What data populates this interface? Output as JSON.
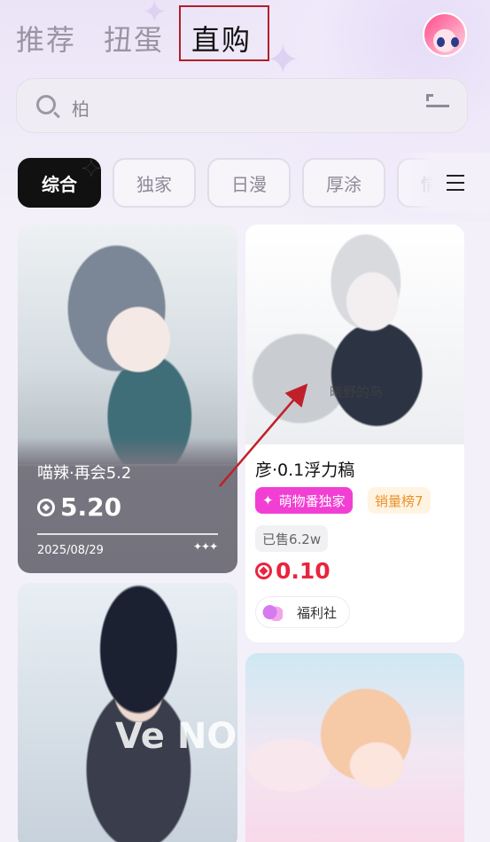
{
  "top_tabs": [
    {
      "label": "推荐",
      "active": false
    },
    {
      "label": "扭蛋",
      "active": false
    },
    {
      "label": "直购",
      "active": true
    }
  ],
  "search": {
    "value": "柏"
  },
  "categories": [
    {
      "label": "综合",
      "active": true
    },
    {
      "label": "独家",
      "active": false
    },
    {
      "label": "日漫",
      "active": false
    },
    {
      "label": "厚涂",
      "active": false
    },
    {
      "label": "情侣",
      "active": false
    }
  ],
  "cards": [
    {
      "title": "喵辣·再会5.2",
      "price": "5.20",
      "date": "2025/08/29",
      "sparkle": "✦✦✦"
    },
    {
      "title": "彦·0.1浮力稿",
      "watermark": "曦野的鸟",
      "tags": [
        "萌物番独家",
        "销量榜7"
      ],
      "sold": "已售6.2w",
      "price": "0.10",
      "shop": "福利社"
    },
    {
      "overlay": "Ve NO"
    },
    {}
  ],
  "colors": {
    "accent_red": "#e8253e",
    "tag_pink": "#f23fd3",
    "highlight_border": "#b1202a"
  }
}
